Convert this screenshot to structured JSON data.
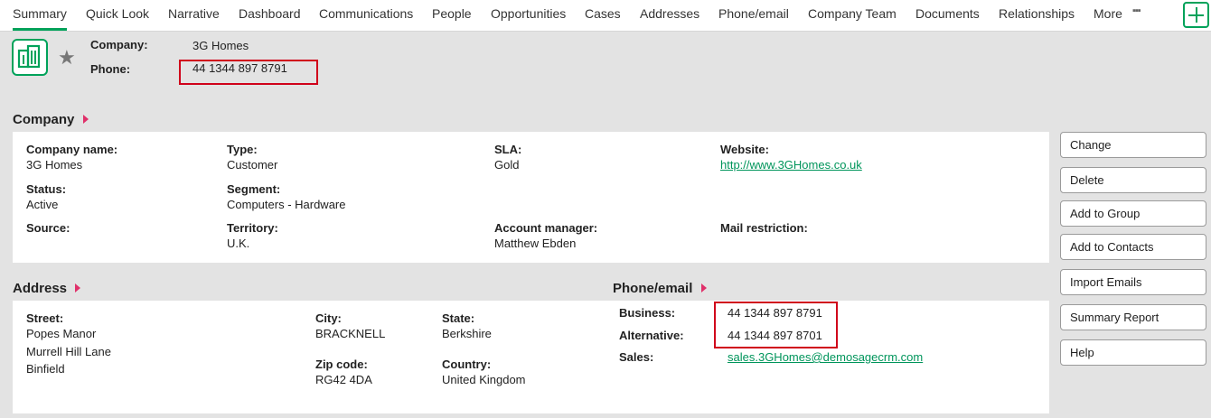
{
  "tabs": [
    {
      "label": "Summary"
    },
    {
      "label": "Quick Look"
    },
    {
      "label": "Narrative"
    },
    {
      "label": "Dashboard"
    },
    {
      "label": "Communications"
    },
    {
      "label": "People"
    },
    {
      "label": "Opportunities"
    },
    {
      "label": "Cases"
    },
    {
      "label": "Addresses"
    },
    {
      "label": "Phone/email"
    },
    {
      "label": "Company Team"
    },
    {
      "label": "Documents"
    },
    {
      "label": "Relationships"
    },
    {
      "label": "More"
    }
  ],
  "header": {
    "company_label": "Company:",
    "company_value": "3G Homes",
    "phone_label": "Phone:",
    "phone_value": "44 1344 897 8791"
  },
  "company_section": {
    "title": "Company",
    "company_name_label": "Company name:",
    "company_name": "3G Homes",
    "type_label": "Type:",
    "type": "Customer",
    "sla_label": "SLA:",
    "sla": "Gold",
    "website_label": "Website:",
    "website": "http://www.3GHomes.co.uk",
    "status_label": "Status:",
    "status": "Active",
    "segment_label": "Segment:",
    "segment": "Computers - Hardware",
    "source_label": "Source:",
    "territory_label": "Territory:",
    "territory": "U.K.",
    "account_manager_label": "Account manager:",
    "account_manager": "Matthew Ebden",
    "mail_restriction_label": "Mail restriction:"
  },
  "address_section": {
    "title": "Address",
    "street_label": "Street:",
    "street_lines": [
      "Popes Manor",
      "Murrell Hill Lane",
      "Binfield"
    ],
    "city_label": "City:",
    "city": "BRACKNELL",
    "state_label": "State:",
    "state": "Berkshire",
    "zip_label": "Zip code:",
    "zip": "RG42 4DA",
    "country_label": "Country:",
    "country": "United Kingdom"
  },
  "phone_section": {
    "title": "Phone/email",
    "business_label": "Business:",
    "business": "44 1344 897 8791",
    "alternative_label": "Alternative:",
    "alternative": "44 1344 897 8701",
    "sales_label": "Sales:",
    "sales_email": "sales.3GHomes@demosagecrm.com"
  },
  "actions": [
    {
      "label": "Change"
    },
    {
      "label": "Delete"
    },
    {
      "label": "Add to Group"
    },
    {
      "label": "Add to Contacts"
    },
    {
      "label": "Import Emails"
    },
    {
      "label": "Summary Report"
    },
    {
      "label": "Help"
    }
  ],
  "colors": {
    "accent": "#00a25a",
    "highlight": "#d0021b",
    "section_arrow": "#e0306a",
    "link": "#00955b"
  }
}
